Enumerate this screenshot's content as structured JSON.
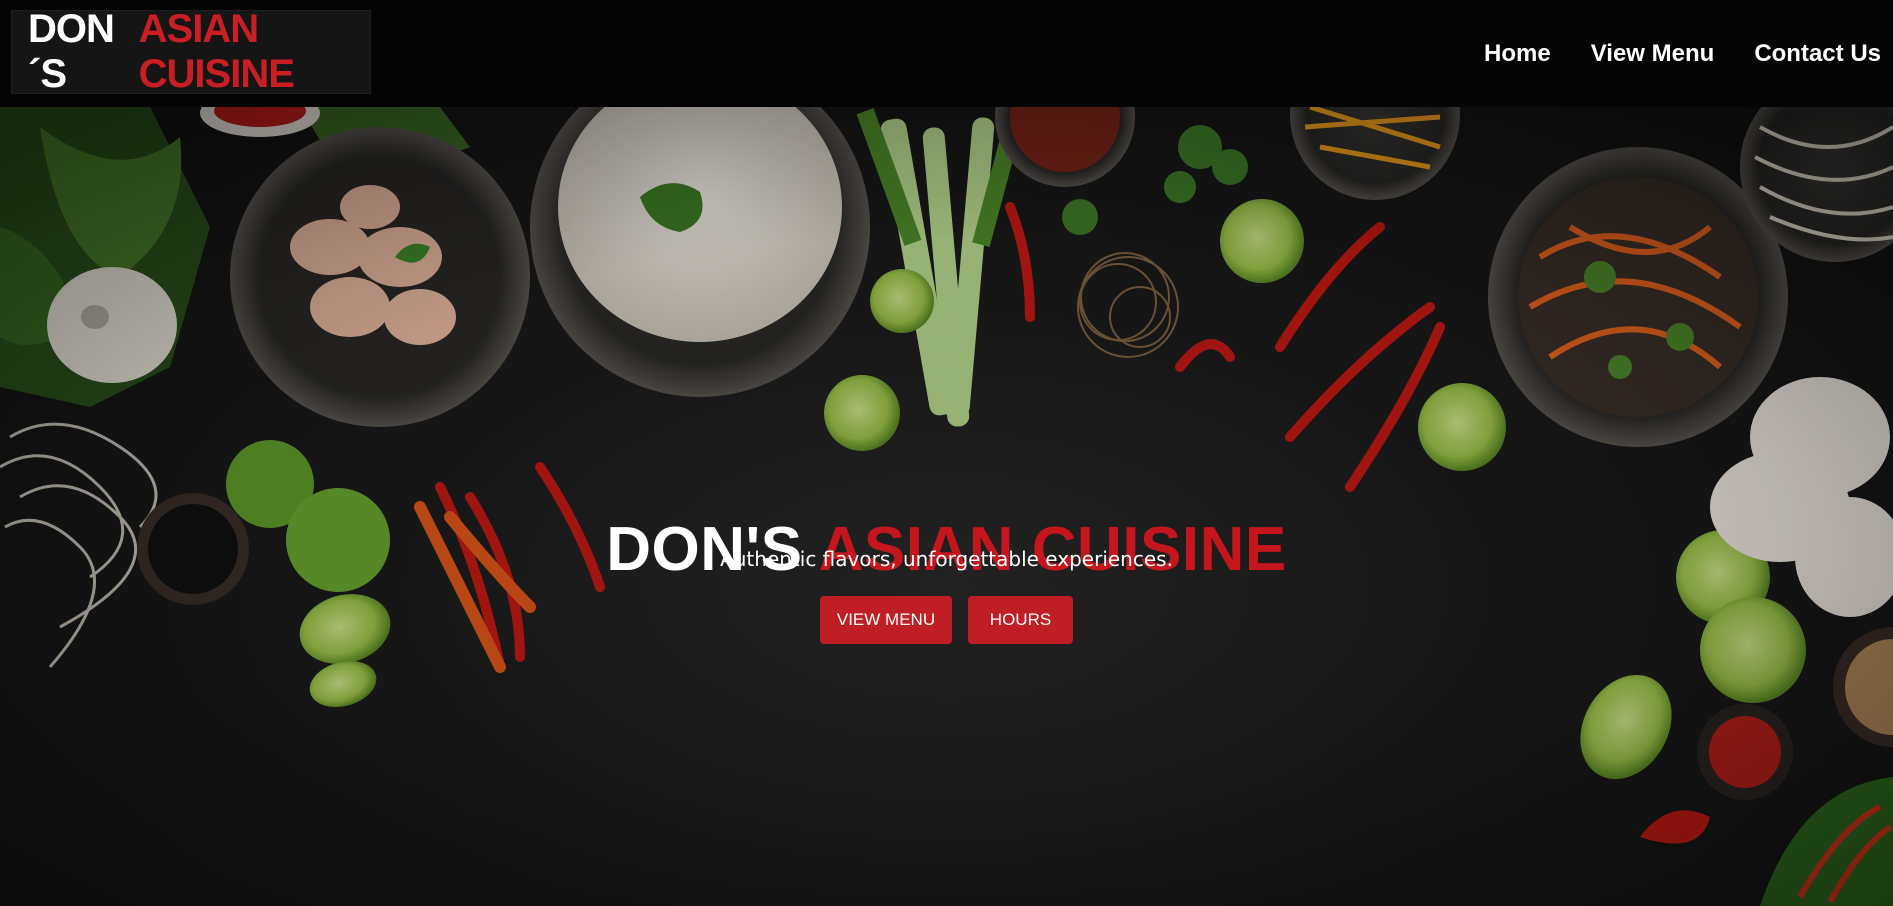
{
  "brand": {
    "logo_word1": "DON´S",
    "logo_word2": "ASIAN CUISINE"
  },
  "nav": {
    "items": [
      "Home",
      "View Menu",
      "Contact Us"
    ]
  },
  "hero": {
    "title_white": "DON'S",
    "title_red": "ASIAN CUISINE",
    "tagline": "Authentic flavors, unforgettable experiences.",
    "buttons": {
      "view_menu": "VIEW MENU",
      "hours": "HOURS"
    }
  },
  "colors": {
    "accent_red": "#c4161c",
    "navbar_bg": "#040404",
    "text_white": "#ffffff"
  }
}
